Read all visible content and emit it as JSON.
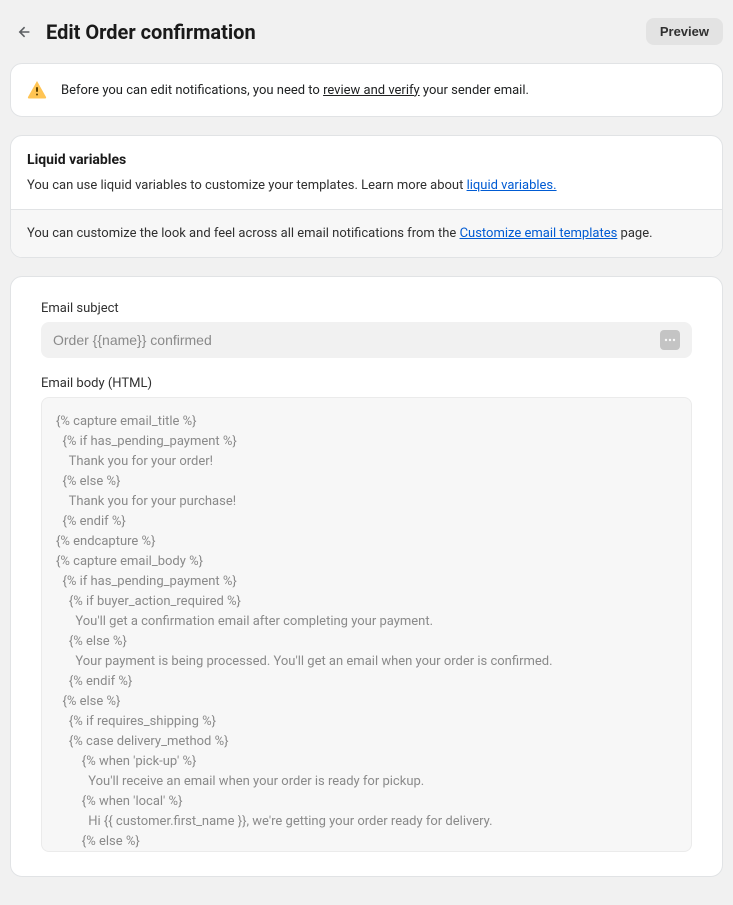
{
  "header": {
    "title": "Edit Order confirmation",
    "preview_label": "Preview"
  },
  "banner": {
    "text_before": "Before you can edit notifications, you need to ",
    "link": "review and verify",
    "text_after": " your sender email."
  },
  "liquid": {
    "title": "Liquid variables",
    "body_before": "You can use liquid variables to customize your templates. Learn more about ",
    "link": "liquid variables."
  },
  "customize": {
    "before": "You can customize the look and feel across all email notifications from the ",
    "link": "Customize email templates",
    "after": " page."
  },
  "editor": {
    "subject_label": "Email subject",
    "subject_value": "Order {{name}} confirmed",
    "body_label": "Email body (HTML)",
    "body_value": "{% capture email_title %}\n  {% if has_pending_payment %}\n    Thank you for your order!\n  {% else %}\n    Thank you for your purchase!\n  {% endif %}\n{% endcapture %}\n{% capture email_body %}\n  {% if has_pending_payment %}\n    {% if buyer_action_required %}\n      You'll get a confirmation email after completing your payment.\n    {% else %}\n      Your payment is being processed. You'll get an email when your order is confirmed.\n    {% endif %}\n  {% else %}\n    {% if requires_shipping %}\n    {% case delivery_method %}\n        {% when 'pick-up' %}\n          You'll receive an email when your order is ready for pickup.\n        {% when 'local' %}\n          Hi {{ customer.first_name }}, we're getting your order ready for delivery.\n        {% else %}\n          We're getting your order ready to be shipped. We will notify you when it has been sent."
  }
}
